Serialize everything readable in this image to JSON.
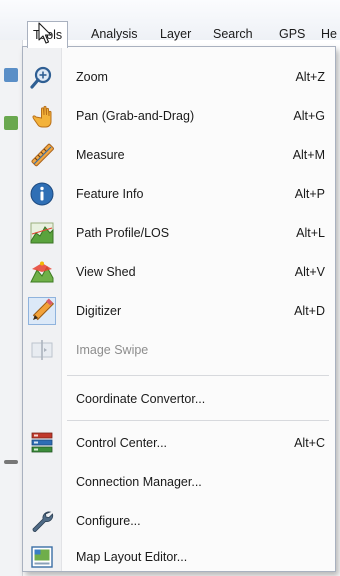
{
  "menubar": {
    "items": [
      {
        "label": "Tools"
      },
      {
        "label": "Analysis"
      },
      {
        "label": "Layer"
      },
      {
        "label": "Search"
      },
      {
        "label": "GPS"
      },
      {
        "label": "He"
      }
    ]
  },
  "menu": {
    "items": [
      {
        "label": "Zoom",
        "shortcut": "Alt+Z",
        "icon": "zoom-icon"
      },
      {
        "label": "Pan (Grab-and-Drag)",
        "shortcut": "Alt+G",
        "icon": "hand-icon"
      },
      {
        "label": "Measure",
        "shortcut": "Alt+M",
        "icon": "ruler-icon"
      },
      {
        "label": "Feature Info",
        "shortcut": "Alt+P",
        "icon": "info-icon"
      },
      {
        "label": "Path Profile/LOS",
        "shortcut": "Alt+L",
        "icon": "path-profile-icon"
      },
      {
        "label": "View Shed",
        "shortcut": "Alt+V",
        "icon": "view-shed-icon"
      },
      {
        "label": "Digitizer",
        "shortcut": "Alt+D",
        "icon": "pencil-icon"
      },
      {
        "label": "Image Swipe",
        "shortcut": "",
        "icon": "image-swipe-icon",
        "disabled": true
      },
      {
        "label": "Coordinate Convertor...",
        "shortcut": "",
        "icon": ""
      },
      {
        "label": "Control Center...",
        "shortcut": "Alt+C",
        "icon": "control-center-icon"
      },
      {
        "label": "Connection Manager...",
        "shortcut": "",
        "icon": ""
      },
      {
        "label": "Configure...",
        "shortcut": "",
        "icon": "wrench-icon"
      },
      {
        "label": "Map Layout Editor...",
        "shortcut": "",
        "icon": "map-layout-icon"
      }
    ]
  },
  "colors": {
    "menu_bg": "#fbfbfb",
    "icon_strip": "#f0f1f3",
    "border": "#a9b1bf",
    "disabled_text": "#8d8d8d"
  }
}
